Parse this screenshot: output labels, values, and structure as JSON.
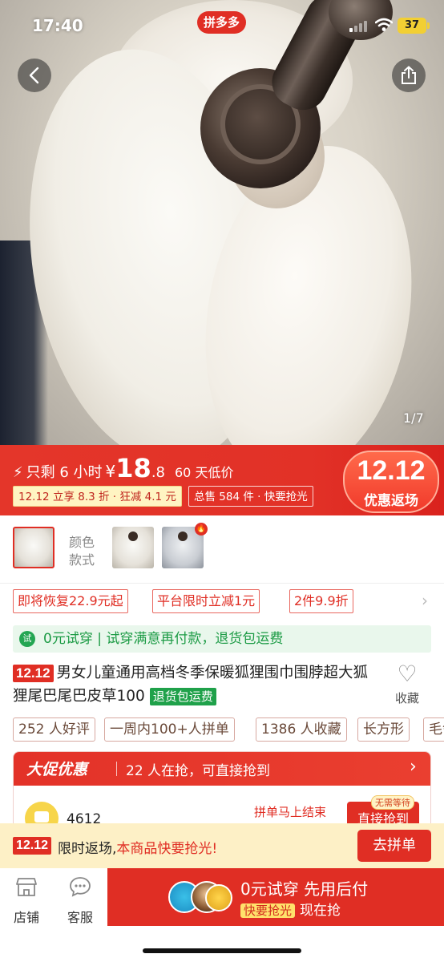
{
  "status_bar": {
    "time": "17:40",
    "app_badge": "拼多多",
    "battery": "37"
  },
  "gallery": {
    "pager": "1/7"
  },
  "price": {
    "remaining": "只剩 6 小时",
    "currency": "¥",
    "int": "18",
    "dec": ".8",
    "low_label": "60 天低价",
    "discount_tag": "12.12 立享 8.3 折 · 狂减 4.1 元",
    "sales_tag": "总售 584 件 · 快要抢光",
    "badge_big": "12.12",
    "badge_small": "优惠返场"
  },
  "variants": {
    "color_label": "颜色",
    "style_label": "款式"
  },
  "coupons": [
    "即将恢复22.9元起",
    "平台限时立减1元",
    "2件9.9折"
  ],
  "trial": {
    "icon_text": "试",
    "text": "0元试穿 | 试穿满意再付款，退货包运费"
  },
  "product": {
    "badge": "12.12",
    "title": "男女儿童通用高档冬季保暖狐狸围巾围脖超大狐狸尾巴尾巴皮草100",
    "return_tag": "退货包运费",
    "fav_label": "收藏"
  },
  "chips": [
    "252 人好评",
    "一周内100+人拼单",
    "1386 人收藏",
    "长方形",
    "毛领"
  ],
  "promo": {
    "logo": "大促优惠",
    "text": "22 人在抢，可直接抢到",
    "user_num": "4612",
    "ending": "拼单马上结束",
    "grab_button": "直接抢到",
    "no_wait": "无需等待"
  },
  "strip": {
    "badge": "12.12",
    "text_a": "限时返场,",
    "text_b": "本商品快要抢光!",
    "button": "去拼单"
  },
  "bottom_bar": {
    "store_label": "店铺",
    "service_label": "客服",
    "cta_line1": "0元试穿 先用后付",
    "cta_pill": "快要抢光",
    "cta_line2": "现在抢"
  },
  "colors": {
    "brand_red": "#e02e24",
    "green": "#1fa14a",
    "strip_bg": "#fdf0c6"
  }
}
